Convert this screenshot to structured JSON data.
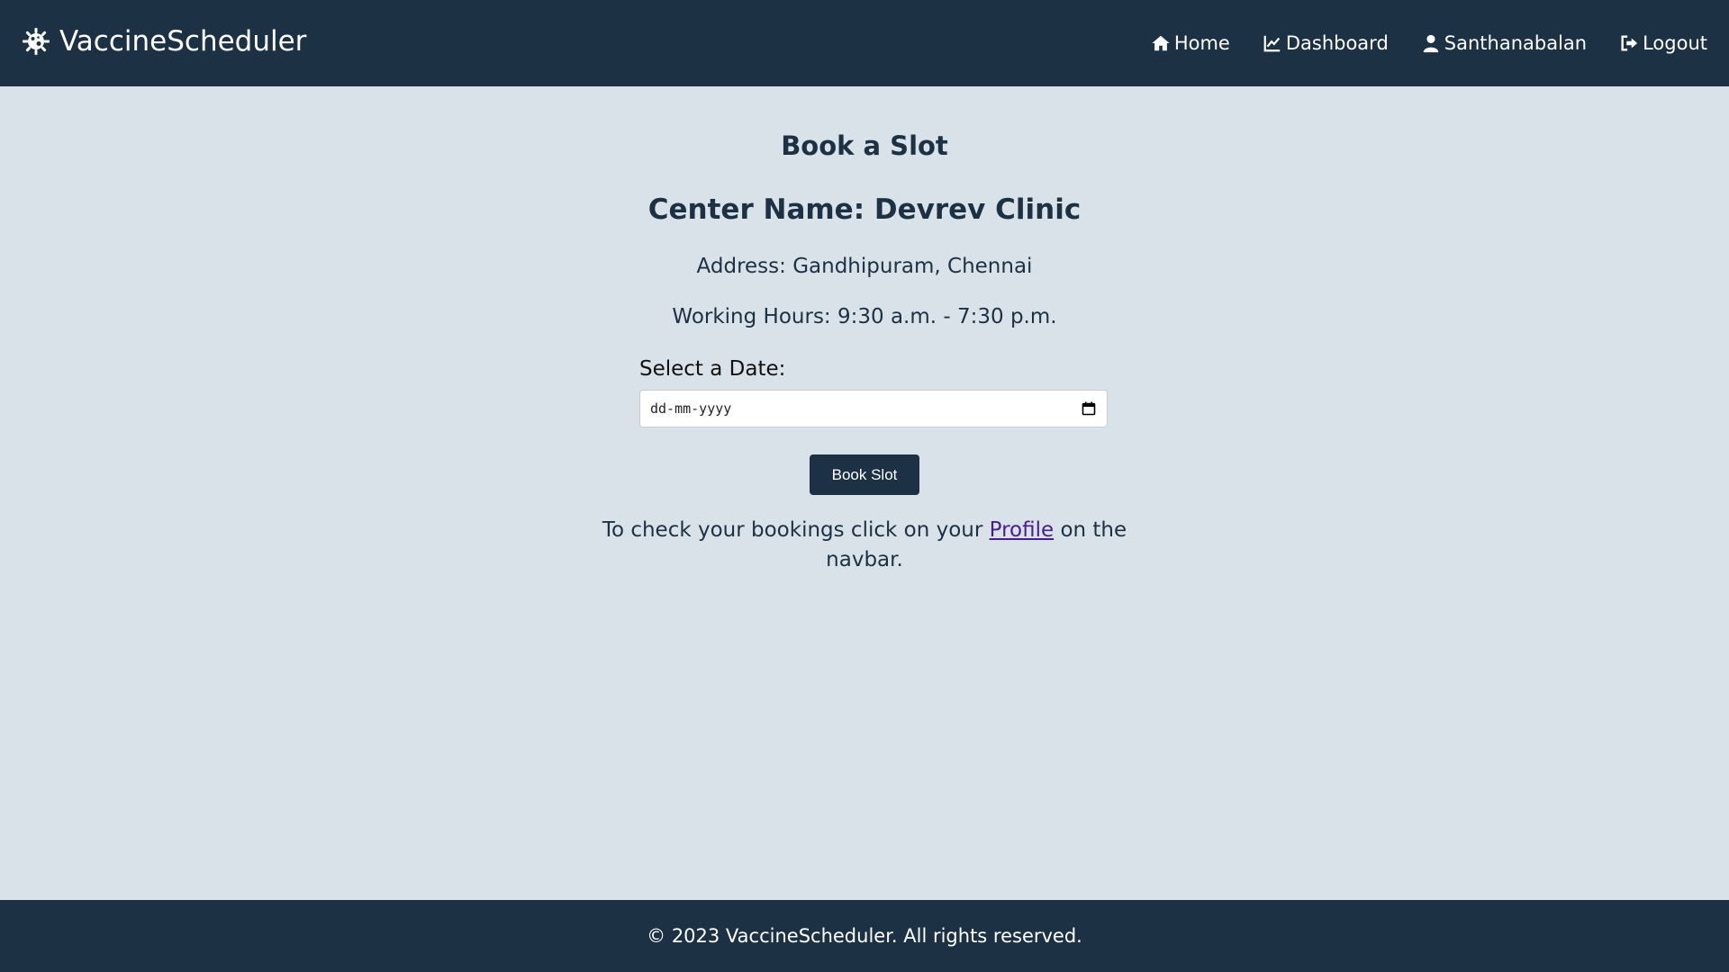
{
  "navbar": {
    "brand": "VaccineScheduler",
    "brand_icon": "virus-icon",
    "links": [
      {
        "label": "Home",
        "icon": "home-icon"
      },
      {
        "label": "Dashboard",
        "icon": "chart-line-icon"
      },
      {
        "label": "Santhanabalan",
        "icon": "user-icon"
      },
      {
        "label": "Logout",
        "icon": "logout-icon"
      }
    ]
  },
  "main": {
    "title": "Book a Slot",
    "center_name": "Center Name: Devrev Clinic",
    "address": "Address: Gandhipuram, Chennai",
    "working_hours": "Working Hours: 9:30 a.m. - 7:30 p.m.",
    "date_label": "Select a Date:",
    "date_placeholder": "dd-mm-yyyy",
    "book_button": "Book Slot",
    "note_prefix": "To check your bookings click on your ",
    "note_link": "Profile",
    "note_suffix": " on the navbar."
  },
  "footer": {
    "text": "© 2023 VaccineScheduler. All rights reserved."
  },
  "colors": {
    "navbar_bg": "#1c3144",
    "page_bg": "#dae2e9",
    "text": "#1d3144",
    "link": "#4a1e8a"
  }
}
